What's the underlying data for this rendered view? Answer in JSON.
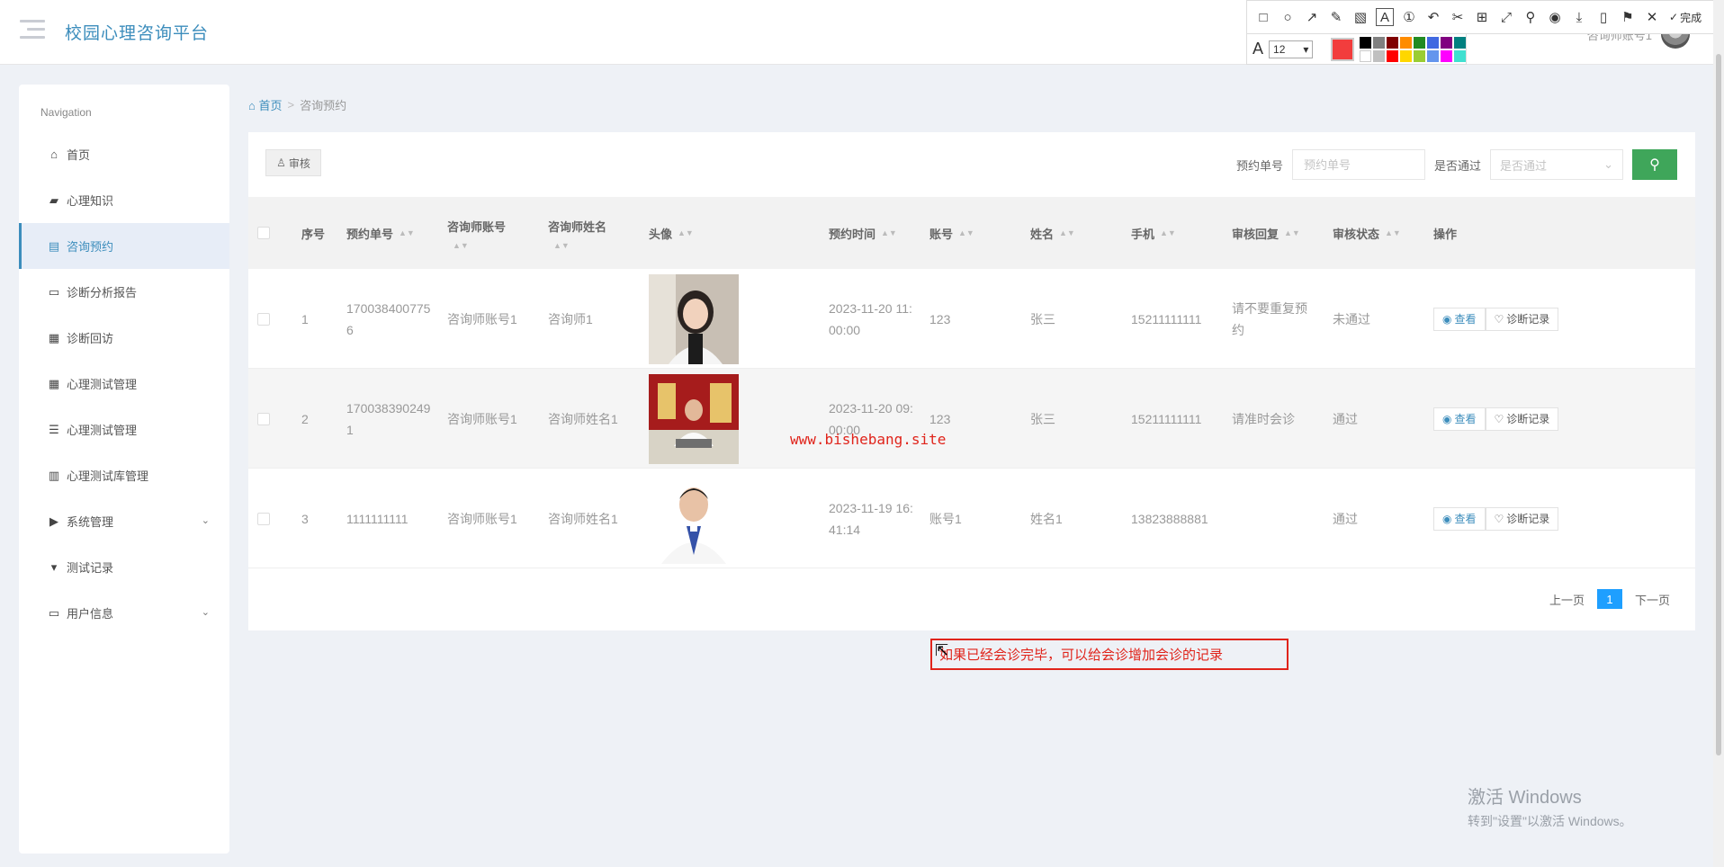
{
  "header": {
    "app_title": "校园心理咨询平台",
    "user_label": "咨询师账号1"
  },
  "snip_tool": {
    "font_size": "12",
    "done_label": "完成",
    "current_color": "#f23d3d",
    "palette": [
      "#000000",
      "#808080",
      "#800000",
      "#ff8c00",
      "#228b22",
      "#4169e1",
      "#800080",
      "#008080",
      "#ffffff",
      "#c0c0c0",
      "#ff0000",
      "#ffd700",
      "#9acd32",
      "#6495ed",
      "#ff00ff",
      "#40e0d0"
    ]
  },
  "sidebar": {
    "heading": "Navigation",
    "items": [
      {
        "label": "首页",
        "icon": "home-icon",
        "glyph": "⌂"
      },
      {
        "label": "心理知识",
        "icon": "briefcase-icon",
        "glyph": "▰"
      },
      {
        "label": "咨询预约",
        "icon": "clipboard-icon",
        "glyph": "▤",
        "active": true
      },
      {
        "label": "诊断分析报告",
        "icon": "monitor-icon",
        "glyph": "▭"
      },
      {
        "label": "诊断回访",
        "icon": "grid-icon",
        "glyph": "▦"
      },
      {
        "label": "心理测试管理",
        "icon": "grid-icon",
        "glyph": "▦"
      },
      {
        "label": "心理测试管理",
        "icon": "list-icon",
        "glyph": "☰"
      },
      {
        "label": "心理测试库管理",
        "icon": "books-icon",
        "glyph": "▥"
      },
      {
        "label": "系统管理",
        "icon": "video-icon",
        "glyph": "▶",
        "expandable": true
      },
      {
        "label": "测试记录",
        "icon": "pin-icon",
        "glyph": "▾"
      },
      {
        "label": "用户信息",
        "icon": "card-icon",
        "glyph": "▭",
        "expandable": true
      }
    ]
  },
  "breadcrumb": {
    "home": "首页",
    "separator": ">",
    "current": "咨询预约"
  },
  "toolbar": {
    "review_label": "审核",
    "order_no_label": "预约单号",
    "order_no_placeholder": "预约单号",
    "passed_label": "是否通过",
    "passed_placeholder": "是否通过"
  },
  "table": {
    "headers": {
      "index": "序号",
      "order_no": "预约单号",
      "counselor_account": "咨询师账号",
      "counselor_name": "咨询师姓名",
      "avatar": "头像",
      "time": "预约时间",
      "account": "账号",
      "name": "姓名",
      "phone": "手机",
      "reply": "审核回复",
      "status": "审核状态",
      "actions": "操作"
    },
    "view_label": "查看",
    "record_label": "诊断记录",
    "rows": [
      {
        "index": "1",
        "order_no": "1700384007756",
        "counselor_account": "咨询师账号1",
        "counselor_name": "咨询师1",
        "time": "2023-11-20 11:00:00",
        "account": "123",
        "name": "张三",
        "phone": "15211111111",
        "reply": "请不要重复预约",
        "status": "未通过"
      },
      {
        "index": "2",
        "order_no": "1700383902491",
        "counselor_account": "咨询师账号1",
        "counselor_name": "咨询师姓名1",
        "time": "2023-11-20 09:00:00",
        "account": "123",
        "name": "张三",
        "phone": "15211111111",
        "reply": "请准时会诊",
        "status": "通过"
      },
      {
        "index": "3",
        "order_no": "1111111111",
        "counselor_account": "咨询师账号1",
        "counselor_name": "咨询师姓名1",
        "time": "2023-11-19 16:41:14",
        "account": "账号1",
        "name": "姓名1",
        "phone": "13823888881",
        "reply": "",
        "status": "通过"
      }
    ]
  },
  "pager": {
    "prev": "上一页",
    "current": "1",
    "next": "下一页"
  },
  "watermark": "www.bishebang.site",
  "annotation": "如果已经会诊完毕，可以给会诊增加会诊的记录",
  "windows_activation": {
    "title": "激活 Windows",
    "subtitle": "转到\"设置\"以激活 Windows。"
  }
}
